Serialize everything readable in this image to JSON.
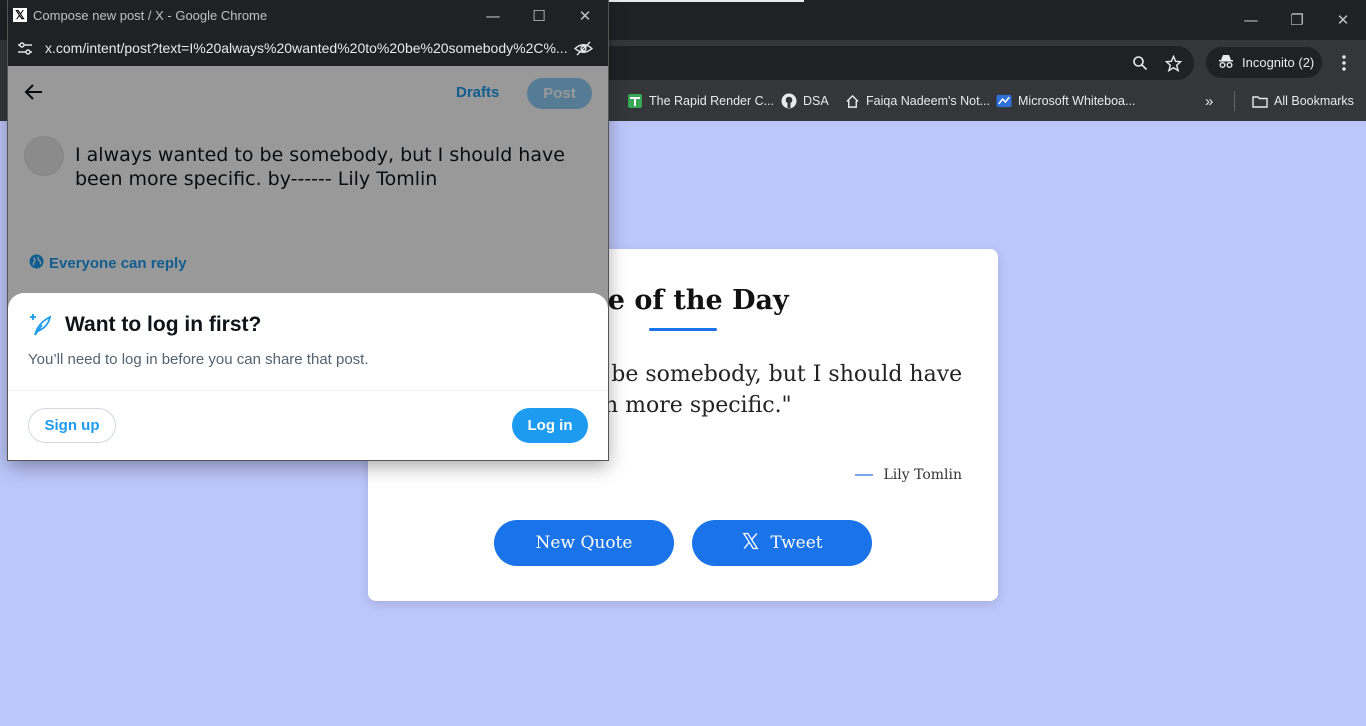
{
  "background_window": {
    "incognito_label": "Incognito (2)",
    "bookmarks": [
      {
        "label": "The Rapid Render C...",
        "icon": "green-doc-icon"
      },
      {
        "label": "DSA",
        "icon": "github-icon"
      },
      {
        "label": "Faiqa Nadeem's Not...",
        "icon": "home-icon"
      },
      {
        "label": "Microsoft Whiteboa...",
        "icon": "whiteboard-icon"
      }
    ],
    "all_bookmarks_label": "All Bookmarks"
  },
  "quote_card": {
    "title": "ote of the Day",
    "quote": "o be somebody, but I should have\nen more specific.\"",
    "author": "Lily Tomlin",
    "new_quote_label": "New Quote",
    "tweet_label": "Tweet",
    "accent_color": "#1a73e8"
  },
  "popup": {
    "window_title": "Compose new post / X - Google Chrome",
    "url": "x.com/intent/post?text=I%20always%20wanted%20to%20be%20somebody%2C%...",
    "drafts_label": "Drafts",
    "post_label": "Post",
    "compose_text": "I always wanted to be somebody, but I should have been more specific. by------ Lily Tomlin",
    "reply_setting": "Everyone can reply",
    "sheet": {
      "title": "Want to log in first?",
      "description": "You’ll need to log in before you can share that post.",
      "signup_label": "Sign up",
      "login_label": "Log in"
    },
    "accent_color": "#1d9bf0"
  }
}
